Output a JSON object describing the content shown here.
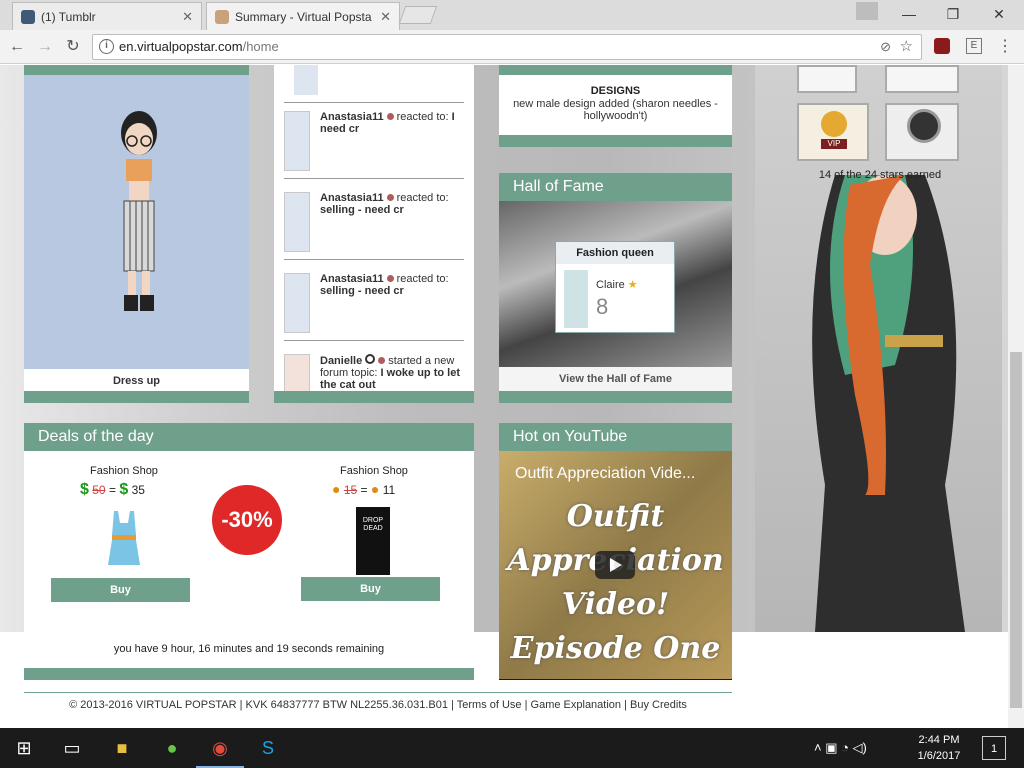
{
  "tabs": [
    {
      "label": "(1) Tumblr",
      "close": "✕",
      "favicon": "tumblr-icon"
    },
    {
      "label": "Summary - Virtual Popsta",
      "close": "✕",
      "favicon": "virtualpopstar-icon"
    }
  ],
  "window": {
    "minimize": "—",
    "restore": "❐",
    "close": "✕"
  },
  "address": {
    "domain": "en.virtualpopstar.com",
    "path": "/home"
  },
  "dressup": {
    "label": "Dress up"
  },
  "feed": [
    {
      "name": "Anastasia11",
      "action": "reacted to:",
      "topic": "I need cr"
    },
    {
      "name": "Anastasia11",
      "action": "reacted to:",
      "topic": "selling - need cr"
    },
    {
      "name": "Anastasia11",
      "action": "reacted to:",
      "topic": "selling - need cr"
    },
    {
      "name": "Danielle",
      "action": "started a new forum topic:",
      "topic": "I woke up to let the cat out"
    }
  ],
  "news": {
    "heading": "DESIGNS",
    "text": "new male design added (sharon needles - hollywoodn't)"
  },
  "hall_of_fame": {
    "title": "Hall of Fame",
    "card_title": "Fashion queen",
    "user": "Claire",
    "score": "8",
    "link": "View the Hall of Fame"
  },
  "stars": {
    "earned": "14 of the 24 stars earned",
    "badge": "VIP"
  },
  "deals": {
    "title": "Deals of the day",
    "left": {
      "shop": "Fashion Shop",
      "old": "50",
      "eq": "=",
      "new": "35",
      "buy": "Buy"
    },
    "discount": "-30%",
    "right": {
      "shop": "Fashion Shop",
      "old": "15",
      "eq": "=",
      "new": "11",
      "buy": "Buy",
      "shirt_text": "DROP DEAD"
    },
    "remaining": "you have 9 hour, 16 minutes and 19 seconds remaining"
  },
  "youtube": {
    "title": "Hot on YouTube",
    "video_title": "Outfit Appreciation Vide...",
    "thumb_lines": [
      "Outfit",
      "Appreciation",
      "Video!",
      "Episode One"
    ]
  },
  "footer": {
    "copyright": "© 2013-2016 VIRTUAL POPSTAR | KVK 64837777 BTW NL2255.36.031.B01 |",
    "links": [
      "Terms of Use",
      "Game Explanation",
      "Buy Credits"
    ],
    "sep": "|"
  },
  "taskbar": {
    "time": "2:44 PM",
    "date": "1/6/2017",
    "notifications": "1"
  }
}
